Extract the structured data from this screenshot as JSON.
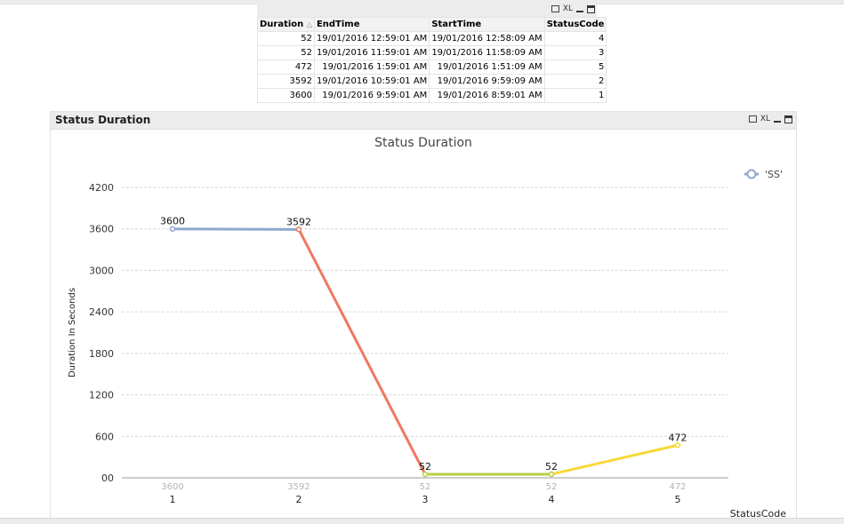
{
  "table": {
    "headers": [
      "Duration",
      "EndTime",
      "StartTime",
      "StatusCode"
    ],
    "sort_indicator": "△",
    "rows": [
      [
        "52",
        "19/01/2016 12:59:01 AM",
        "19/01/2016 12:58:09 AM",
        "4"
      ],
      [
        "52",
        "19/01/2016 11:59:01 AM",
        "19/01/2016 11:58:09 AM",
        "3"
      ],
      [
        "472",
        "19/01/2016 1:59:01 AM",
        "19/01/2016 1:51:09 AM",
        "5"
      ],
      [
        "3592",
        "19/01/2016 10:59:01 AM",
        "19/01/2016 9:59:09 AM",
        "2"
      ],
      [
        "3600",
        "19/01/2016 9:59:01 AM",
        "19/01/2016 8:59:01 AM",
        "1"
      ]
    ],
    "icons": [
      "print-icon",
      "xl-export-icon",
      "minimize-icon",
      "maximize-icon"
    ],
    "xl_label": "XL"
  },
  "chart_box": {
    "caption": "Status Duration",
    "xl_label": "XL"
  },
  "chart_data": {
    "type": "line",
    "title": "Status Duration",
    "xlabel": "StatusCode",
    "ylabel": "Duration In Seconds",
    "categories": [
      "1",
      "2",
      "3",
      "4",
      "5"
    ],
    "series": [
      {
        "name": "'SS'",
        "values": [
          3600,
          3592,
          52,
          52,
          472
        ]
      }
    ],
    "data_labels": [
      "3600",
      "3592",
      "52",
      "52",
      "472"
    ],
    "category_sublabels": [
      "3600",
      "3592",
      "52",
      "52",
      "472"
    ],
    "yticks": [
      0,
      600,
      1200,
      1800,
      2400,
      3000,
      3600,
      4200
    ],
    "ytick_labels": [
      "00",
      "600",
      "1200",
      "1800",
      "2400",
      "3000",
      "3600",
      "4200"
    ],
    "ylim": [
      0,
      4200
    ],
    "grid": true,
    "legend_position": "top-right",
    "segment_colors": [
      "#8fa8d0",
      "#f07860",
      "#b8cc44",
      "#f8d838"
    ],
    "point_colors": [
      "#8fa8d0",
      "#f07860",
      "#b8cc44",
      "#b8cc44",
      "#f8d838"
    ]
  }
}
